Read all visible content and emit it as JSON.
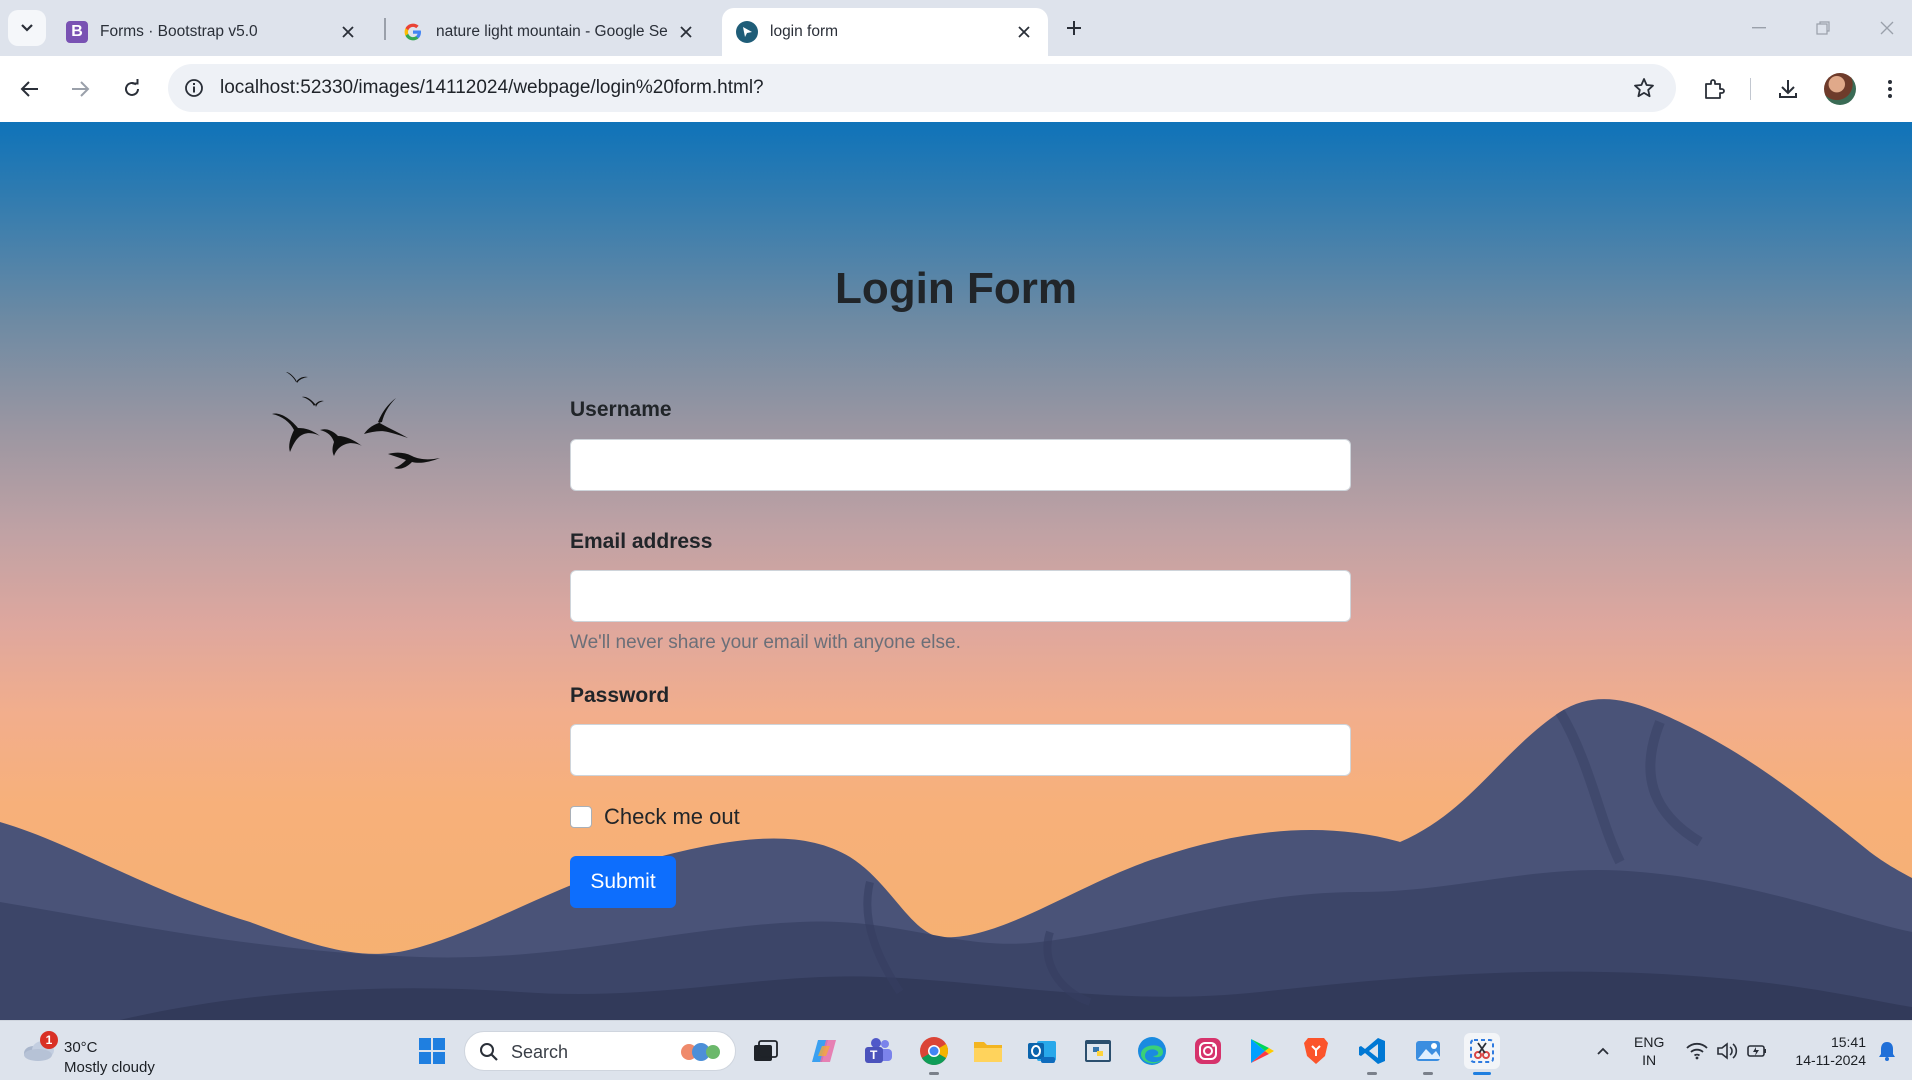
{
  "browser": {
    "tabs": [
      {
        "title": "Forms · Bootstrap v5.0",
        "icon": "bootstrap-icon",
        "favicon_letter": "B",
        "favicon_color": "#7952b3"
      },
      {
        "title": "nature light mountain - Google Se",
        "icon": "google-icon"
      },
      {
        "title": "login form",
        "icon": "page-icon",
        "active": true
      }
    ],
    "url": "localhost:52330/images/14112024/webpage/login%20form.html?"
  },
  "page": {
    "title": "Login Form",
    "username_label": "Username",
    "username_value": "",
    "email_label": "Email address",
    "email_value": "",
    "email_help": "We'll never share your email with anyone else.",
    "password_label": "Password",
    "password_value": "",
    "checkbox_label": "Check me out",
    "checkbox_checked": false,
    "submit_label": "Submit",
    "accent_color": "#0d6efd"
  },
  "taskbar": {
    "weather_badge": "1",
    "temperature": "30°C",
    "condition": "Mostly cloudy",
    "search_label": "Search",
    "language": "ENG",
    "region": "IN",
    "time": "15:41",
    "date": "14-11-2024",
    "apps": [
      "start-icon",
      "task-view-icon",
      "copilot-icon",
      "teams-icon",
      "chrome-icon",
      "file-explorer-icon",
      "outlook-icon",
      "python-icon",
      "edge-icon",
      "instagram-icon",
      "play-store-icon",
      "brave-icon",
      "vscode-icon",
      "paint-icon",
      "snipping-tool-icon"
    ]
  }
}
